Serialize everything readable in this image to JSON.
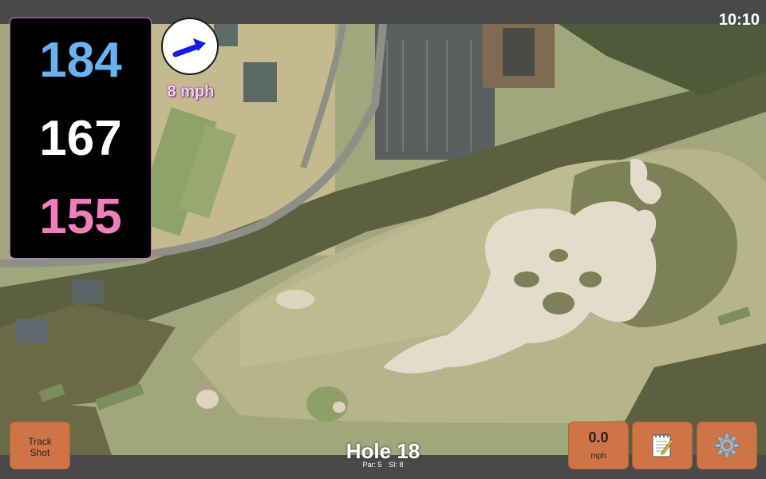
{
  "status": {
    "time": "10:10"
  },
  "distances": {
    "back": "184",
    "middle": "167",
    "front": "155"
  },
  "wind": {
    "speed_label": "8 mph",
    "icon": "arrow-icon",
    "arrow_color": "#1a1ae6"
  },
  "hole": {
    "title": "Hole 18",
    "par_label": "Par: 5",
    "si_label": "SI: 8"
  },
  "buttons": {
    "track_line1": "Track",
    "track_line2": "Shot",
    "speed_value": "0.0",
    "speed_unit": "mph",
    "notes_icon": "notepad-icon",
    "settings_icon": "gear-icon"
  },
  "colors": {
    "back_distance": "#6ab2f0",
    "middle_distance": "#ffffff",
    "front_distance": "#f27ec0",
    "button_bg": "#cf7447",
    "panel_border": "#c070c8"
  }
}
